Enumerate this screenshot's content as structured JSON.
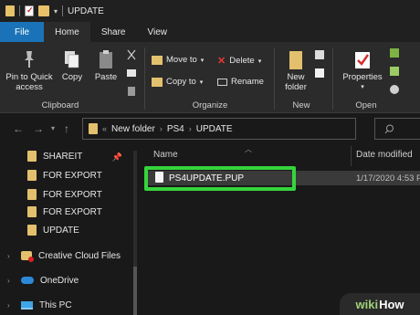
{
  "window": {
    "title": "UPDATE"
  },
  "ribbon_tabs": [
    {
      "label": "File"
    },
    {
      "label": "Home"
    },
    {
      "label": "Share"
    },
    {
      "label": "View"
    }
  ],
  "ribbon": {
    "clipboard": {
      "pin_label_1": "Pin to Quick",
      "pin_label_2": "access",
      "copy_label": "Copy",
      "paste_label": "Paste",
      "group_label": "Clipboard"
    },
    "organize": {
      "move_to_label": "Move to",
      "copy_to_label": "Copy to",
      "delete_label": "Delete",
      "rename_label": "Rename",
      "group_label": "Organize"
    },
    "new": {
      "new_folder_label_1": "New",
      "new_folder_label_2": "folder",
      "group_label": "New"
    },
    "open": {
      "properties_label": "Properties",
      "group_label": "Open"
    }
  },
  "address": {
    "prefix": "«",
    "crumbs": [
      "New folder",
      "PS4",
      "UPDATE"
    ]
  },
  "nav_pane": {
    "items": [
      {
        "label": "SHAREIT",
        "type": "folder",
        "pinned": true
      },
      {
        "label": "FOR EXPORT",
        "type": "folder"
      },
      {
        "label": "FOR EXPORT",
        "type": "folder"
      },
      {
        "label": "FOR EXPORT",
        "type": "folder"
      },
      {
        "label": "UPDATE",
        "type": "folder"
      },
      {
        "label": "Creative Cloud Files",
        "type": "cloud-app"
      },
      {
        "label": "OneDrive",
        "type": "onedrive"
      },
      {
        "label": "This PC",
        "type": "pc"
      }
    ]
  },
  "file_list": {
    "columns": [
      "Name",
      "Date modified"
    ],
    "rows": [
      {
        "name": "PS4UPDATE.PUP",
        "date": "1/17/2020 4:53 P"
      }
    ]
  },
  "watermark": {
    "part1": "wiki",
    "part2": "How"
  },
  "colors": {
    "file_tab": "#1a73b8",
    "highlight": "#36d43c",
    "folder": "#e3c06d"
  }
}
